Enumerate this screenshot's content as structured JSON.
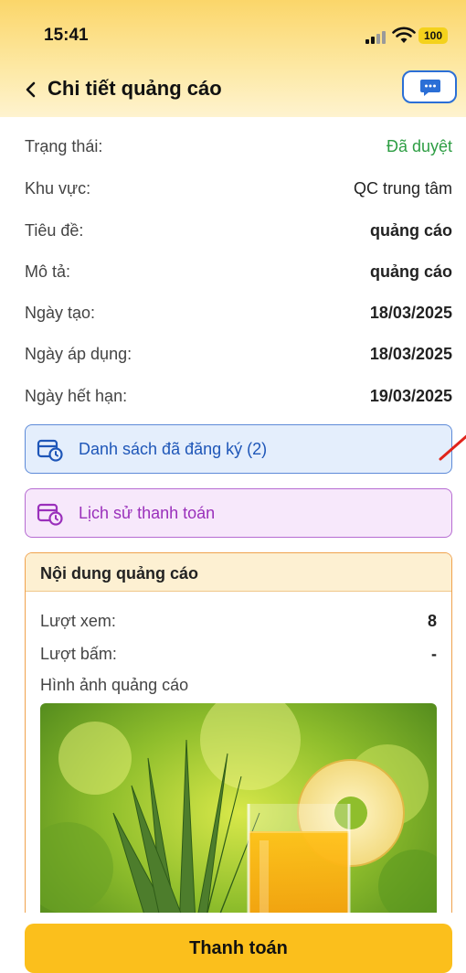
{
  "status_bar": {
    "time": "15:41",
    "battery": "100"
  },
  "nav": {
    "title": "Chi tiết quảng cáo"
  },
  "details": [
    {
      "label": "Trạng thái:",
      "value": "Đã duyệt"
    },
    {
      "label": "Khu vực:",
      "value": "QC trung tâm"
    },
    {
      "label": "Tiêu đề:",
      "value": "quảng cáo"
    },
    {
      "label": "Mô tả:",
      "value": "quảng cáo"
    },
    {
      "label": "Ngày tạo:",
      "value": "18/03/2025"
    },
    {
      "label": "Ngày áp dụng:",
      "value": "18/03/2025"
    },
    {
      "label": "Ngày hết hạn:",
      "value": "19/03/2025"
    }
  ],
  "actions": {
    "registered_list": "Danh sách đã đăng ký (2)",
    "payment_history": "Lịch sử thanh toán"
  },
  "ad_content": {
    "heading": "Nội dung quảng cáo",
    "views_label": "Lượt xem:",
    "views_value": "8",
    "clicks_label": "Lượt bấm:",
    "clicks_value": "-",
    "image_label": "Hình ảnh quảng cáo"
  },
  "footer": {
    "pay_label": "Thanh toán"
  },
  "colors": {
    "accent_yellow": "#fbbf1c",
    "status_ok": "#2e9e44",
    "blue": "#1e56b8",
    "purple": "#9a30bb",
    "orange_border": "#f0a24d"
  }
}
